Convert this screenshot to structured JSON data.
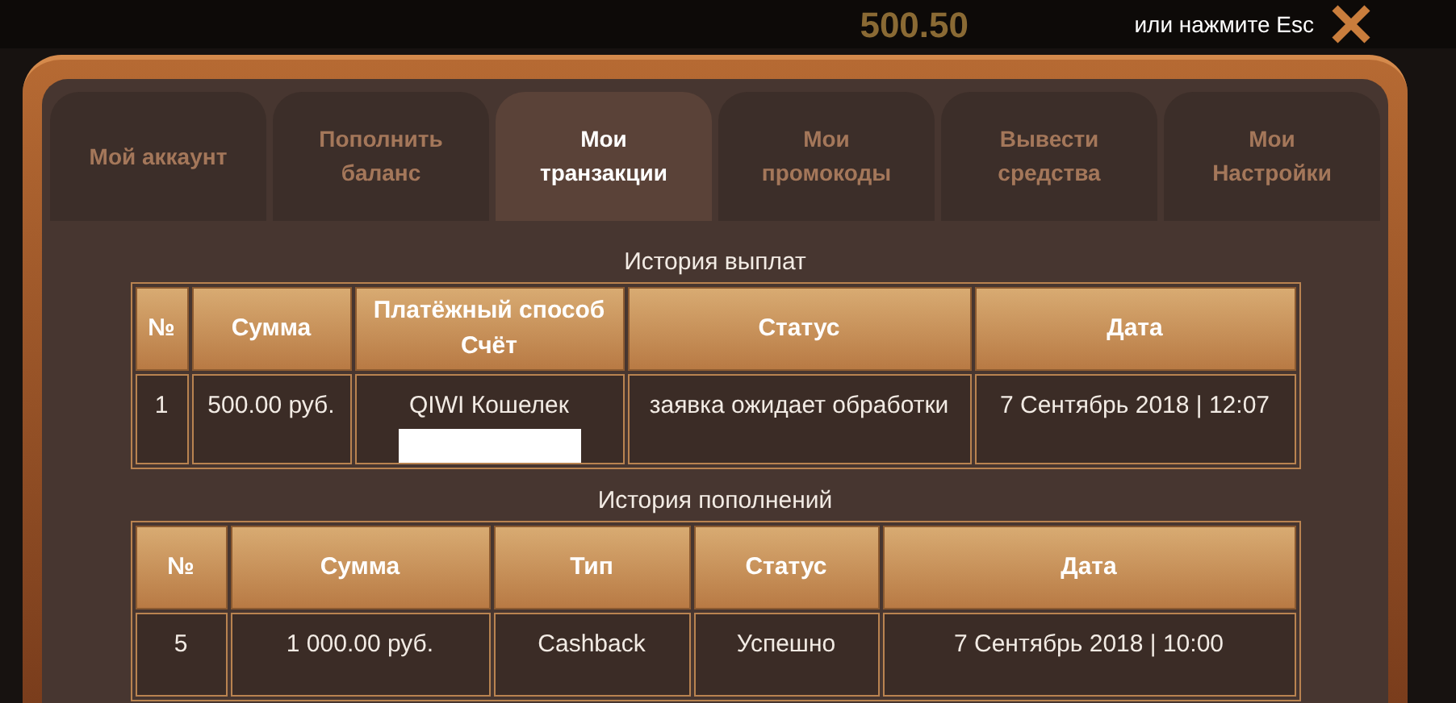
{
  "background": {
    "balance": "500.50"
  },
  "close_hint": "или нажмите Esc",
  "tabs": [
    {
      "label": "Мой аккаунт",
      "selected": false
    },
    {
      "label": "Пополнить баланс",
      "selected": false
    },
    {
      "label": "Мои транзакции",
      "selected": true
    },
    {
      "label": "Мои промокоды",
      "selected": false
    },
    {
      "label": "Вывести средства",
      "selected": false
    },
    {
      "label": "Мои Настройки",
      "selected": false
    }
  ],
  "payouts": {
    "title": "История выплат",
    "columns": [
      "№",
      "Сумма",
      "Платёжный способ Счёт",
      "Статус",
      "Дата"
    ],
    "rows": [
      {
        "cells": [
          "1",
          "500.00 руб.",
          "QIWI Кошелек",
          "заявка ожидает обработки",
          "7 Сентябрь 2018 | 12:07"
        ],
        "account_redacted": true
      }
    ]
  },
  "deposits": {
    "title": "История пополнений",
    "columns": [
      "№",
      "Сумма",
      "Тип",
      "Статус",
      "Дата"
    ],
    "rows": [
      {
        "cells": [
          "5",
          "1 000.00 руб.",
          "Cashback",
          "Успешно",
          "7 Сентябрь 2018 | 10:00"
        ]
      }
    ]
  }
}
